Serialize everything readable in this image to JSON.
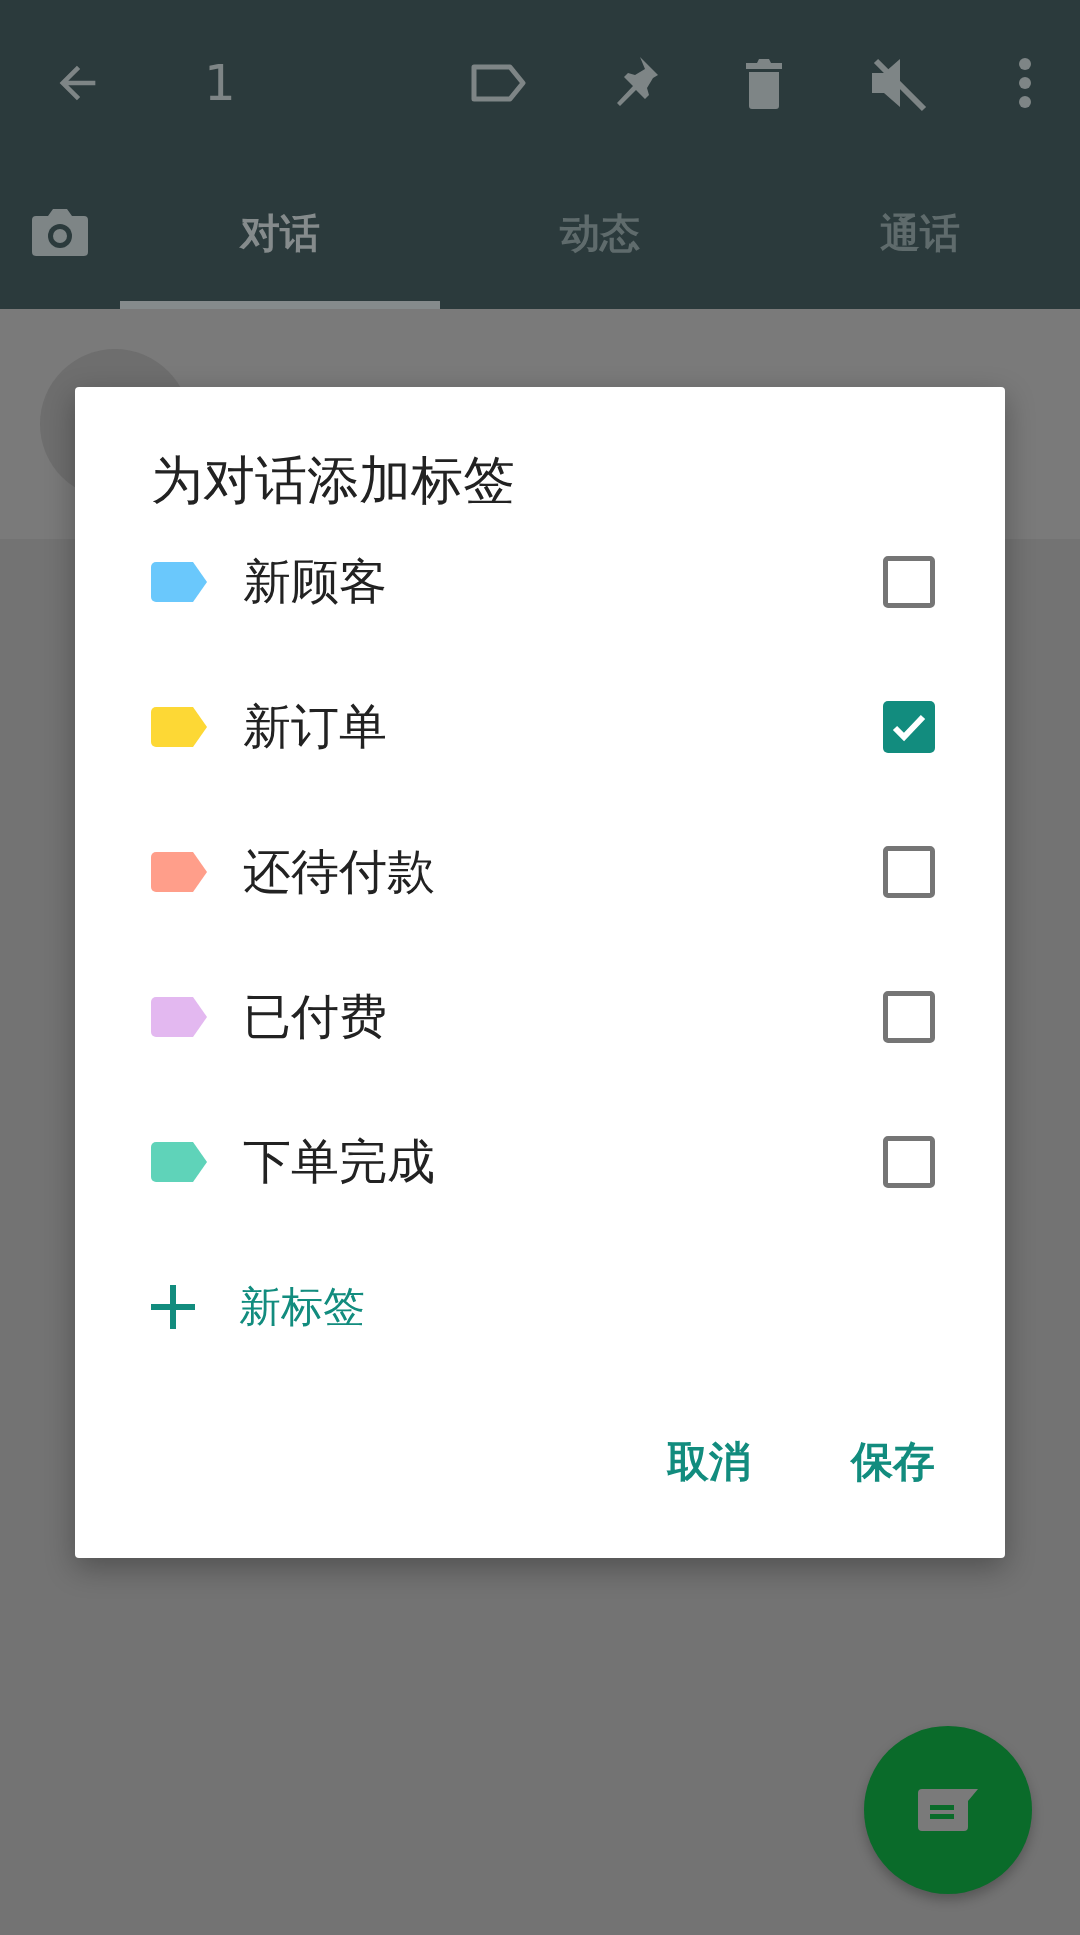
{
  "toolbar": {
    "selected_count": "1"
  },
  "tabs": [
    {
      "label": "对话",
      "selected": true
    },
    {
      "label": "动态",
      "selected": false
    },
    {
      "label": "通话",
      "selected": false
    }
  ],
  "dialog": {
    "title": "为对话添加标签",
    "labels": [
      {
        "name": "新顾客",
        "color": "#6ac8fc",
        "checked": false
      },
      {
        "name": "新订单",
        "color": "#fdd835",
        "checked": true
      },
      {
        "name": "还待付款",
        "color": "#ff9e8a",
        "checked": false
      },
      {
        "name": "已付费",
        "color": "#e3b8f0",
        "checked": false
      },
      {
        "name": "下单完成",
        "color": "#5fd3b9",
        "checked": false
      }
    ],
    "new_label": "新标签",
    "buttons": [
      {
        "label": "取消"
      },
      {
        "label": "保存"
      }
    ]
  }
}
